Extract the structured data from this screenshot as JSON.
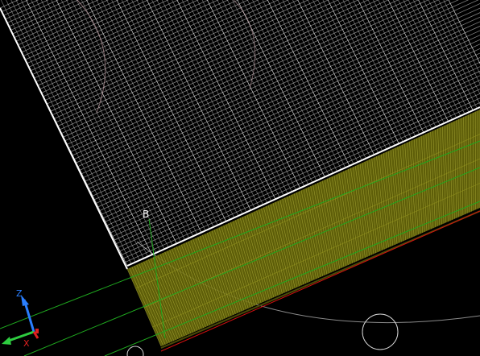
{
  "viewport": {
    "background": "#000000",
    "mesh_color": "#ffffff",
    "edge_face_color": "#7a7a10",
    "edge_face_line_color": "#c8c84a",
    "construction_line_color": "#1fa81f",
    "datum_line_color": "#d01010",
    "orbit_color": "#9a9a9a"
  },
  "point_label": "B",
  "axis_gizmo": {
    "z_label": "Z",
    "x_label": "X",
    "colors": {
      "z": "#2a7fff",
      "x": "#e02020",
      "y": "#2ecc40"
    }
  }
}
